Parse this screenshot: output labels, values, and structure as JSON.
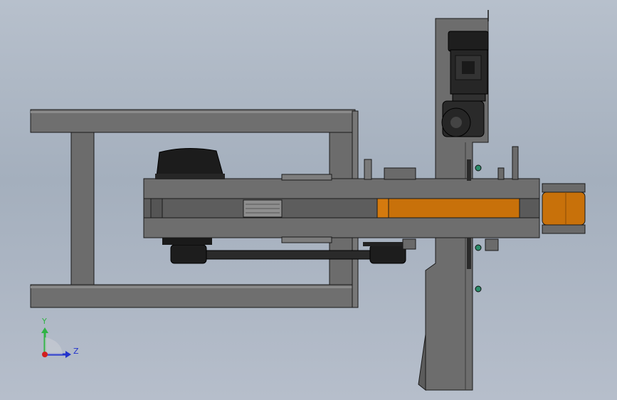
{
  "viewport": {
    "background_top": "#b7c0cc",
    "background_bottom": "#b6becb"
  },
  "colors": {
    "frame_gray": "#6f6f6f",
    "steel_dark": "#4a4a4a",
    "motor_black": "#1e1e1e",
    "orange_tube": "#c8710a",
    "edge": "#1a1a1a"
  },
  "triad": {
    "y_label": "Y",
    "z_label": "Z",
    "y_color": "#2fb344",
    "z_color": "#2233cc",
    "origin_color": "#d21f1f"
  }
}
